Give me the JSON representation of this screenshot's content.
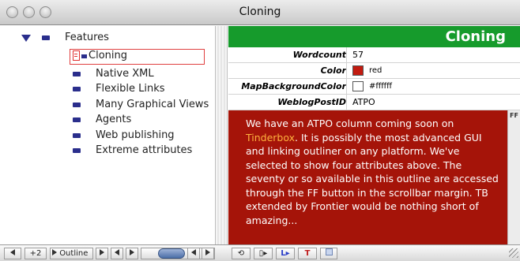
{
  "window": {
    "title": "Cloning"
  },
  "outline": {
    "root": "Features",
    "items": [
      {
        "label": "Cloning"
      },
      {
        "label": "Native XML"
      },
      {
        "label": "Flexible Links"
      },
      {
        "label": "Many Graphical Views"
      },
      {
        "label": "Agents"
      },
      {
        "label": "Web publishing"
      },
      {
        "label": "Extreme attributes"
      }
    ]
  },
  "note": {
    "title": "Cloning",
    "title_color": "#169b2c",
    "attributes": [
      {
        "name": "Wordcount",
        "value": "57"
      },
      {
        "name": "Color",
        "value": "red",
        "swatch": "#c21b10"
      },
      {
        "name": "MapBackgroundColor",
        "value": "#ffffff",
        "swatch": "#ffffff"
      },
      {
        "name": "WeblogPostID",
        "value": "ATPO"
      }
    ],
    "text_before_link": "We have an ATPO column coming soon on ",
    "link_text": "Tinderbox",
    "text_after_link": ". It is possibly the most advanced GUI and linking outliner on any platform. We've selected to show four attributes above. The seventy or so available in this outline are accessed through the FF button in the scrollbar margin. TB extended by Frontier would be nothing short of amazing...",
    "background": "#a51409",
    "ff_button": "FF"
  },
  "bottombar": {
    "zoom": "+2",
    "view_label": "Outline"
  }
}
